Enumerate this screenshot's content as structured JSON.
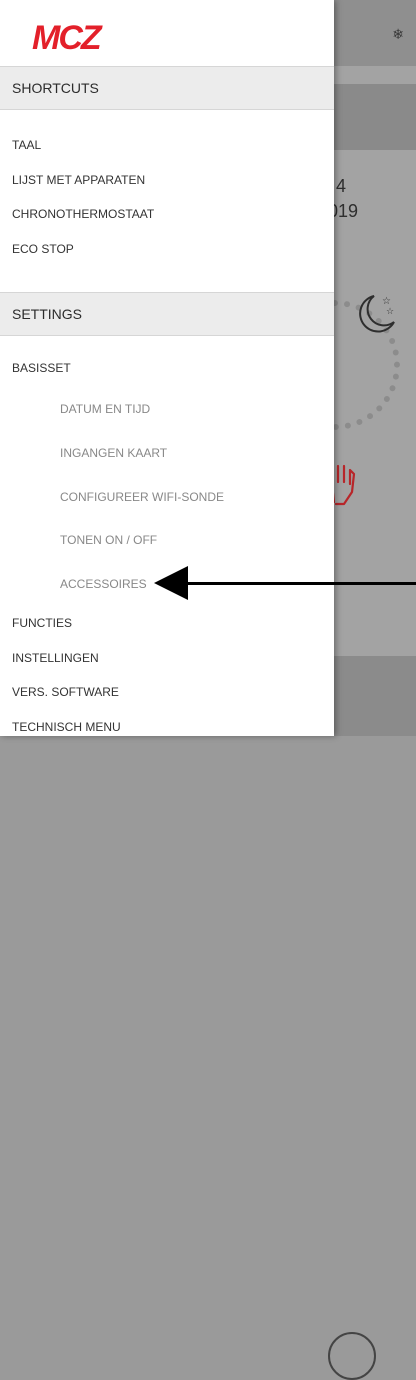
{
  "background": {
    "date_line1": "4",
    "date_line2": "019",
    "snowflake_icon": "snowflake-icon",
    "moon_icon": "moon-stars-icon",
    "hand_icon": "hand-icon"
  },
  "drawer": {
    "logo_text": "MCZ",
    "logo_color": "#e3202a",
    "shortcuts": {
      "header": "SHORTCUTS",
      "items": [
        "TAAL",
        "LIJST MET APPARATEN",
        "CHRONOTHERMOSTAAT",
        "ECO STOP"
      ]
    },
    "settings": {
      "header": "SETTINGS",
      "basisset": "BASISSET",
      "sub_items": [
        "DATUM EN TIJD",
        "INGANGEN KAART",
        "CONFIGUREER WIFI-SONDE",
        "TONEN ON / OFF",
        "ACCESSOIRES"
      ],
      "items": [
        "FUNCTIES",
        "INSTELLINGEN",
        "VERS. SOFTWARE",
        "TECHNISCH MENU"
      ]
    }
  }
}
